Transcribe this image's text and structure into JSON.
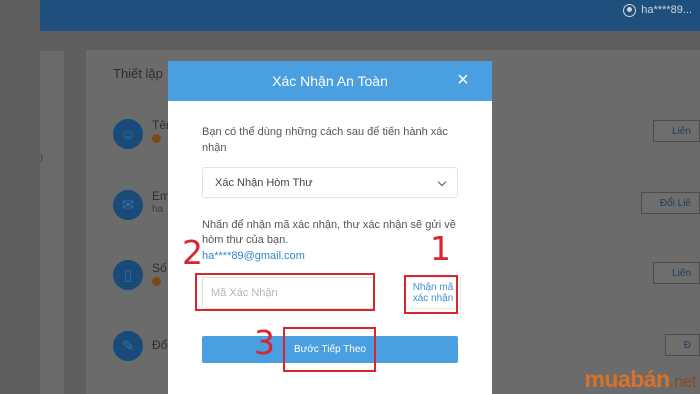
{
  "header": {
    "user_name": "ha****89..."
  },
  "sidebar": {
    "fragment": ")"
  },
  "settings": {
    "title": "Thiết lập",
    "rows": [
      {
        "label": "Tên",
        "sub": "",
        "button": "Liên"
      },
      {
        "label": "Em",
        "sub": "ha",
        "button": "Đổi Liê"
      },
      {
        "label": "Số",
        "sub": "",
        "button": "Liên"
      },
      {
        "label": "Đổi",
        "sub": "",
        "button": "Đ"
      }
    ]
  },
  "modal": {
    "title": "Xác Nhận An Toàn",
    "intro": "Bạn có thể dùng những cách sau để tiến hành xác nhận",
    "method_selected": "Xác Nhận Hòm Thư",
    "hint": "Nhấn để nhận mã xác nhận, thư xác nhận sẽ gửi về hòm thư của bạn.",
    "email": "ha****89@gmail.com",
    "code_placeholder": "Mã Xác Nhận",
    "get_code_label": "Nhận mã xác nhận",
    "next_label": "Bước Tiếp Theo"
  },
  "annotations": {
    "num1": "1",
    "num2": "2",
    "num3": "3"
  },
  "watermark": {
    "brand": "muabán",
    "tld": ".net"
  },
  "colors": {
    "accent": "#4a9fe0",
    "annotation": "#d8262d",
    "link": "#2e86c9"
  },
  "icons": {
    "close": "close-icon",
    "chevron": "chevron-down-icon"
  }
}
